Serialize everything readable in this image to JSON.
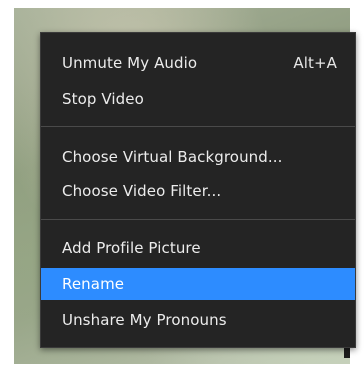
{
  "menu": {
    "sections": [
      [
        {
          "label": "Unmute My Audio",
          "shortcut": "Alt+A"
        },
        {
          "label": "Stop Video"
        }
      ],
      [
        {
          "label": "Choose Virtual Background..."
        },
        {
          "label": "Choose Video Filter..."
        }
      ],
      [
        {
          "label": "Add Profile Picture"
        },
        {
          "label": "Rename",
          "highlighted": true
        },
        {
          "label": "Unshare My Pronouns"
        }
      ]
    ]
  },
  "colors": {
    "menu_background": "#242424",
    "highlight": "#2d8cff",
    "text": "#ececec",
    "separator": "#4a4a4a"
  }
}
